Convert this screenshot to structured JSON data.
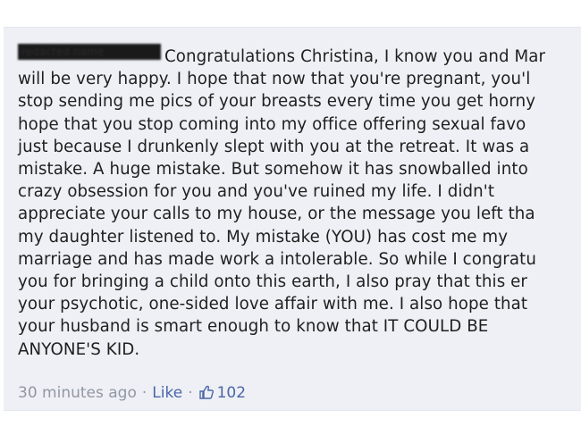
{
  "comment": {
    "author_redacted": "redacted name",
    "lines": [
      "Congratulations Christina, I know you and Mar",
      "will be very happy. I hope that now that you're pregnant, you'l",
      "stop sending me pics of your breasts every time you get horny",
      "hope that you stop coming into my office offering sexual favo",
      "just because I drunkenly slept with you at the retreat. It was a",
      "mistake. A huge mistake. But somehow it has snowballed into",
      "crazy obsession for you and you've ruined my life. I didn't",
      "appreciate your calls to my house, or the message you left tha",
      "my daughter listened to. My mistake (YOU) has cost me my",
      "marriage and has made work a intolerable. So while I congratu",
      "you for bringing a child onto this earth, I also pray that this er",
      "your psychotic, one-sided love affair with me. I also hope that",
      "your husband is smart enough to know that IT COULD BE",
      "ANYONE'S KID."
    ]
  },
  "meta": {
    "timestamp": "30 minutes ago",
    "separator": "·",
    "like_label": "Like",
    "like_icon": "thumbs-up-icon",
    "like_count": "102"
  },
  "colors": {
    "comment_bg": "#eef0f5",
    "link": "#4a66a8",
    "meta_text": "#9197a3"
  }
}
